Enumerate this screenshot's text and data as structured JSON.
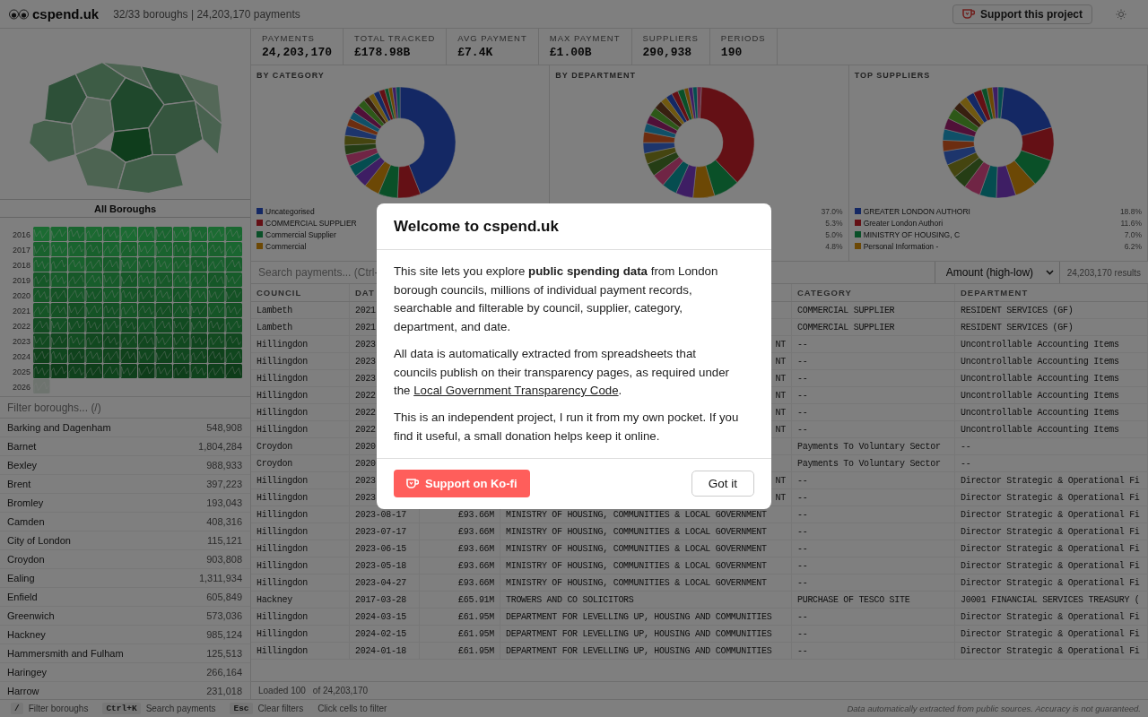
{
  "header": {
    "brand": "cspend.uk",
    "summary": "32/33 boroughs | 24,203,170 payments",
    "support_button": "Support this project"
  },
  "sidebar": {
    "map_title": "All Boroughs",
    "years": [
      "2016",
      "2017",
      "2018",
      "2019",
      "2020",
      "2021",
      "2022",
      "2023",
      "2024",
      "2025",
      "2026"
    ],
    "filter": {
      "placeholder": "Filter boroughs... (/)"
    },
    "boroughs": [
      {
        "name": "Barking and Dagenham",
        "count": "548,908"
      },
      {
        "name": "Barnet",
        "count": "1,804,284"
      },
      {
        "name": "Bexley",
        "count": "988,933"
      },
      {
        "name": "Brent",
        "count": "397,223"
      },
      {
        "name": "Bromley",
        "count": "193,043"
      },
      {
        "name": "Camden",
        "count": "408,316"
      },
      {
        "name": "City of London",
        "count": "115,121"
      },
      {
        "name": "Croydon",
        "count": "903,808"
      },
      {
        "name": "Ealing",
        "count": "1,311,934"
      },
      {
        "name": "Enfield",
        "count": "605,849"
      },
      {
        "name": "Greenwich",
        "count": "573,036"
      },
      {
        "name": "Hackney",
        "count": "985,124"
      },
      {
        "name": "Hammersmith and Fulham",
        "count": "125,513"
      },
      {
        "name": "Haringey",
        "count": "266,164"
      },
      {
        "name": "Harrow",
        "count": "231,018"
      }
    ]
  },
  "stats": [
    {
      "label": "PAYMENTS",
      "value": "24,203,170"
    },
    {
      "label": "TOTAL TRACKED",
      "value": "£178.98B"
    },
    {
      "label": "AVG PAYMENT",
      "value": "£7.4K"
    },
    {
      "label": "MAX PAYMENT",
      "value": "£1.00B"
    },
    {
      "label": "SUPPLIERS",
      "value": "290,938"
    },
    {
      "label": "PERIODS",
      "value": "190"
    }
  ],
  "charts": [
    {
      "title": "BY CATEGORY",
      "legend": [
        {
          "label": "Uncategorised",
          "color": "#142864"
        },
        {
          "label": "COMMERCIAL SUPPLIER",
          "color": "#641015"
        },
        {
          "label": "Commercial Supplier",
          "color": "#0a5028"
        },
        {
          "label": "Commercial",
          "color": "#6c4805"
        }
      ]
    },
    {
      "title": "BY DEPARTMENT",
      "legend": [
        {
          "pct": "37.0%"
        },
        {
          "pct": "5.3%"
        },
        {
          "pct": "5.0%"
        },
        {
          "pct": "4.8%"
        }
      ]
    },
    {
      "title": "TOP SUPPLIERS",
      "legend": [
        {
          "label": "GREATER LONDON AUTHORI",
          "pct": "18.8%",
          "color": "#142864"
        },
        {
          "label": "Greater London Authori",
          "pct": "11.6%",
          "color": "#641015"
        },
        {
          "label": "MINISTRY OF HOUSING, C",
          "pct": "7.0%",
          "color": "#0a5028"
        },
        {
          "label": "Personal Information -",
          "pct": "6.2%",
          "color": "#6c4805"
        }
      ]
    }
  ],
  "search": {
    "placeholder": "Search payments... (Ctrl-",
    "sort": "Amount (high-low)",
    "results": "24,203,170 results"
  },
  "table": {
    "columns": [
      "COUNCIL",
      "DAT",
      null,
      null,
      "CATEGORY",
      "DEPARTMENT"
    ],
    "rows": [
      {
        "cells": [
          "Lambeth",
          "2021",
          null,
          null,
          "COMMERCIAL SUPPLIER",
          "RESIDENT SERVICES (GF)"
        ]
      },
      {
        "cells": [
          "Lambeth",
          "2021",
          null,
          null,
          "COMMERCIAL SUPPLIER",
          "RESIDENT SERVICES (GF)"
        ]
      },
      {
        "covered": true,
        "cells": [
          "Hillingdon",
          "2023",
          null,
          "NT",
          "--",
          "Uncontrollable Accounting Items"
        ]
      },
      {
        "covered": true,
        "cells": [
          "Hillingdon",
          "2023",
          null,
          "NT",
          "--",
          "Uncontrollable Accounting Items"
        ]
      },
      {
        "covered": true,
        "cells": [
          "Hillingdon",
          "2023",
          null,
          "NT",
          "--",
          "Uncontrollable Accounting Items"
        ]
      },
      {
        "covered": true,
        "cells": [
          "Hillingdon",
          "2022",
          null,
          "NT",
          "--",
          "Uncontrollable Accounting Items"
        ]
      },
      {
        "covered": true,
        "cells": [
          "Hillingdon",
          "2022",
          null,
          "NT",
          "--",
          "Uncontrollable Accounting Items"
        ]
      },
      {
        "covered": true,
        "cells": [
          "Hillingdon",
          "2022",
          null,
          "NT",
          "--",
          "Uncontrollable Accounting Items"
        ]
      },
      {
        "cells": [
          "Croydon",
          "2020",
          null,
          null,
          "Payments To Voluntary Sector",
          "--"
        ]
      },
      {
        "cells": [
          "Croydon",
          "2020",
          null,
          null,
          "Payments To Voluntary Sector",
          "--"
        ]
      },
      {
        "covered": true,
        "cells": [
          "Hillingdon",
          "2023",
          null,
          "NT",
          "--",
          "Director Strategic & Operational Fi"
        ]
      },
      {
        "covered": true,
        "cells": [
          "Hillingdon",
          "2023",
          null,
          "NT",
          "--",
          "Director Strategic & Operational Fi"
        ]
      },
      {
        "covered": false,
        "cells": [
          "Hillingdon",
          "2023-08-17",
          "£93.66M",
          "MINISTRY OF HOUSING, COMMUNITIES & LOCAL GOVERNMENT",
          "--",
          "Director Strategic & Operational Fi"
        ]
      },
      {
        "covered": false,
        "cells": [
          "Hillingdon",
          "2023-07-17",
          "£93.66M",
          "MINISTRY OF HOUSING, COMMUNITIES & LOCAL GOVERNMENT",
          "--",
          "Director Strategic & Operational Fi"
        ]
      },
      {
        "covered": false,
        "cells": [
          "Hillingdon",
          "2023-06-15",
          "£93.66M",
          "MINISTRY OF HOUSING, COMMUNITIES & LOCAL GOVERNMENT",
          "--",
          "Director Strategic & Operational Fi"
        ]
      },
      {
        "covered": false,
        "cells": [
          "Hillingdon",
          "2023-05-18",
          "£93.66M",
          "MINISTRY OF HOUSING, COMMUNITIES & LOCAL GOVERNMENT",
          "--",
          "Director Strategic & Operational Fi"
        ]
      },
      {
        "covered": false,
        "cells": [
          "Hillingdon",
          "2023-04-27",
          "£93.66M",
          "MINISTRY OF HOUSING, COMMUNITIES & LOCAL GOVERNMENT",
          "--",
          "Director Strategic & Operational Fi"
        ]
      },
      {
        "covered": false,
        "cells": [
          "Hackney",
          "2017-03-28",
          "£65.91M",
          "TROWERS AND CO SOLICITORS",
          "PURCHASE OF TESCO SITE",
          "J0001 FINANCIAL SERVICES TREASURY ("
        ]
      },
      {
        "covered": false,
        "cells": [
          "Hillingdon",
          "2024-03-15",
          "£61.95M",
          "DEPARTMENT FOR LEVELLING UP, HOUSING AND COMMUNITIES",
          "--",
          "Director Strategic & Operational Fi"
        ]
      },
      {
        "covered": false,
        "cells": [
          "Hillingdon",
          "2024-02-15",
          "£61.95M",
          "DEPARTMENT FOR LEVELLING UP, HOUSING AND COMMUNITIES",
          "--",
          "Director Strategic & Operational Fi"
        ]
      },
      {
        "covered": false,
        "cells": [
          "Hillingdon",
          "2024-01-18",
          "£61.95M",
          "DEPARTMENT FOR LEVELLING UP, HOUSING AND COMMUNITIES",
          "--",
          "Director Strategic & Operational Fi"
        ]
      }
    ],
    "loaded": "Loaded 100",
    "total": "of 24,203,170"
  },
  "footer": {
    "hints": [
      {
        "key": "/",
        "label": "Filter boroughs"
      },
      {
        "key": "Ctrl+K",
        "label": "Search payments"
      },
      {
        "key": "Esc",
        "label": "Clear filters"
      },
      {
        "label": "Click cells to filter"
      }
    ],
    "note": "Data automatically extracted from public sources. Accuracy is not guaranteed."
  },
  "modal": {
    "title": "Welcome to cspend.uk",
    "paragraphs": [
      {
        "text": "This site lets you explore **public spending data** from London borough councils, millions of individual payment records, searchable and filterable by council, supplier, category, department, and date."
      },
      {
        "text": "All data is automatically extracted from spreadsheets that councils publish on their transparency pages, as required under the ",
        "link": "Local Government Transparency Code",
        "after": "."
      },
      {
        "text": "This is an independent project, I run it from my own pocket. If you find it useful, a small donation helps keep it online."
      }
    ],
    "primary_button": "Support on Ko-fi",
    "secondary_button": "Got it"
  }
}
